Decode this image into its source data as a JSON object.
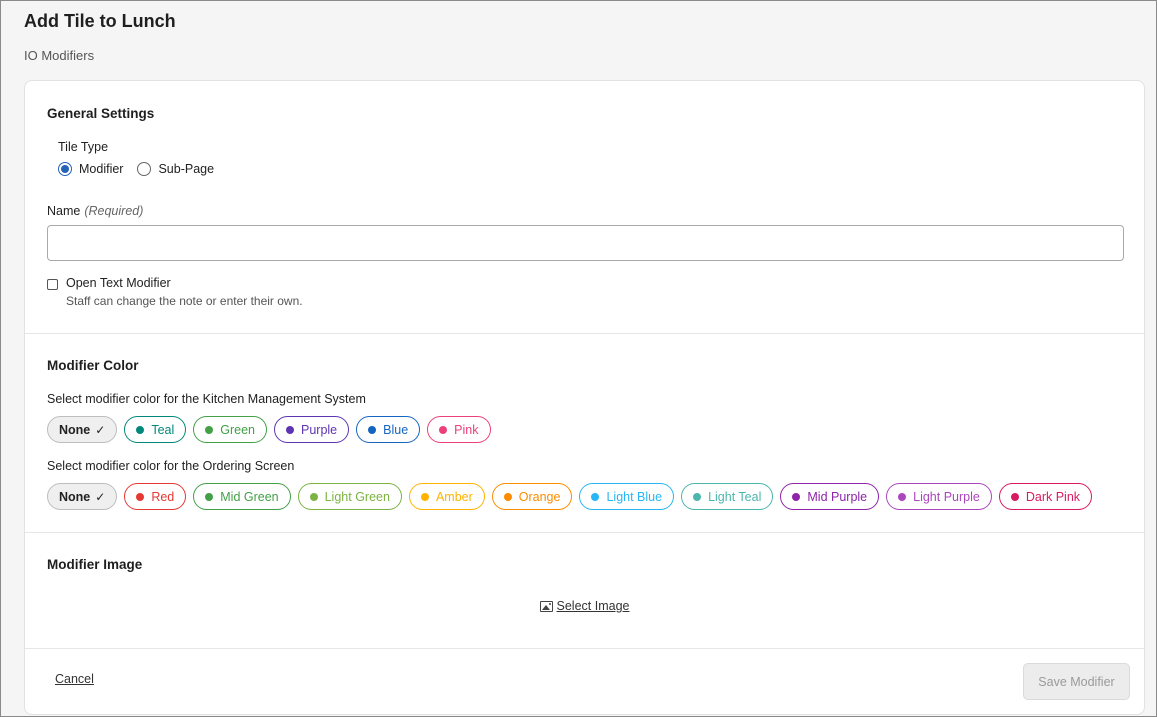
{
  "header": {
    "title": "Add Tile to Lunch",
    "subtitle": "IO Modifiers"
  },
  "general": {
    "title": "General Settings",
    "tile_type_label": "Tile Type",
    "tile_type_options": [
      {
        "label": "Modifier",
        "checked": true
      },
      {
        "label": "Sub-Page",
        "checked": false
      }
    ],
    "name_label": "Name",
    "name_required": "(Required)",
    "name_value": "",
    "open_text_label": "Open Text Modifier",
    "open_text_checked": false,
    "open_text_hint": "Staff can change the note or enter their own."
  },
  "modifier_color": {
    "title": "Modifier Color",
    "kms_label": "Select modifier color for the Kitchen Management System",
    "kms_none": "None",
    "kms_colors": [
      {
        "label": "Teal",
        "color": "#00897b"
      },
      {
        "label": "Green",
        "color": "#43a047"
      },
      {
        "label": "Purple",
        "color": "#5e35b1"
      },
      {
        "label": "Blue",
        "color": "#1565c0"
      },
      {
        "label": "Pink",
        "color": "#ec407a"
      }
    ],
    "ordering_label": "Select modifier color for the Ordering Screen",
    "ordering_none": "None",
    "ordering_colors": [
      {
        "label": "Red",
        "color": "#e53935"
      },
      {
        "label": "Mid Green",
        "color": "#43a047"
      },
      {
        "label": "Light Green",
        "color": "#7cb342"
      },
      {
        "label": "Amber",
        "color": "#ffb300"
      },
      {
        "label": "Orange",
        "color": "#fb8c00"
      },
      {
        "label": "Light Blue",
        "color": "#29b6f6"
      },
      {
        "label": "Light Teal",
        "color": "#4db6ac"
      },
      {
        "label": "Mid Purple",
        "color": "#8e24aa"
      },
      {
        "label": "Light Purple",
        "color": "#ab47bc"
      },
      {
        "label": "Dark Pink",
        "color": "#d81b60"
      }
    ]
  },
  "modifier_image": {
    "title": "Modifier Image",
    "select_label": "Select Image"
  },
  "footer": {
    "cancel_label": "Cancel",
    "save_label": "Save Modifier"
  }
}
